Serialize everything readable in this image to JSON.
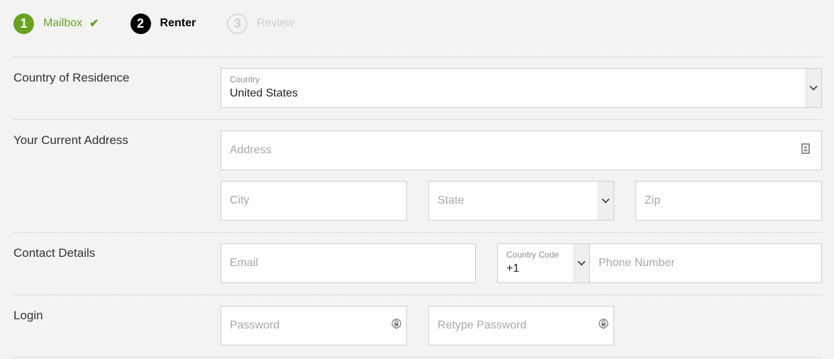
{
  "steps": [
    {
      "number": "1",
      "label": "Mailbox",
      "state": "done",
      "check": "✔"
    },
    {
      "number": "2",
      "label": "Renter",
      "state": "active"
    },
    {
      "number": "3",
      "label": "Review",
      "state": "todo"
    }
  ],
  "sections": {
    "country": {
      "label": "Country of Residence",
      "select": {
        "label": "Country",
        "value": "United States"
      }
    },
    "address": {
      "label": "Your Current Address",
      "address_placeholder": "Address",
      "city_placeholder": "City",
      "state_placeholder": "State",
      "zip_placeholder": "Zip"
    },
    "contact": {
      "label": "Contact Details",
      "email_placeholder": "Email",
      "country_code": {
        "label": "Country Code",
        "value": "+1"
      },
      "phone_placeholder": "Phone Number"
    },
    "login": {
      "label": "Login",
      "password_placeholder": "Password",
      "retype_placeholder": "Retype Password"
    }
  },
  "icons": {
    "address": "contact-card-icon",
    "password": "lock-icon",
    "select": "chevron-down-icon"
  },
  "colors": {
    "done": "#66a31f",
    "active": "#000000",
    "todo": "#cfcfcf",
    "background": "#f3f3f3"
  }
}
